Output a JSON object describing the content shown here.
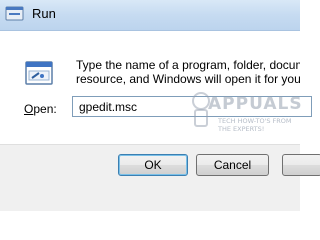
{
  "window": {
    "title": "Run",
    "icon": "run-icon"
  },
  "dialog": {
    "icon": "run-program-icon",
    "description_line1": "Type the name of a program, folder, document, or",
    "description_line2": "resource, and Windows will open it for you.",
    "open_label_accesskey": "O",
    "open_label_rest": "pen:",
    "open_value": "gpedit.msc"
  },
  "buttons": {
    "ok_label": "OK",
    "cancel_label": "Cancel",
    "browse_label": ""
  },
  "watermark": {
    "brand": "APPUALS",
    "tagline_line1": "TECH HOW-TO'S FROM",
    "tagline_line2": "THE EXPERTS!"
  },
  "colors": {
    "titlebar": "#c6dbf1",
    "button_bar": "#f0f0f0",
    "input_border": "#7f9db9",
    "default_button_border": "#3c7fb1"
  }
}
